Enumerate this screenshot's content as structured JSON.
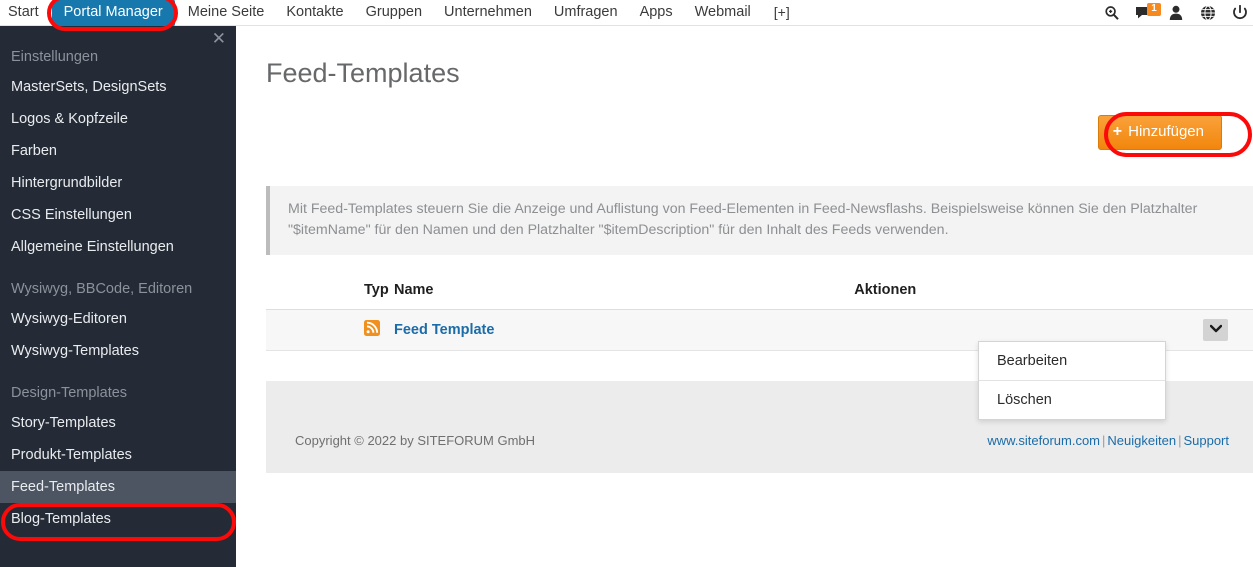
{
  "topnav": {
    "items": [
      {
        "label": "Start",
        "active": false
      },
      {
        "label": "Portal Manager",
        "active": true
      },
      {
        "label": "Meine Seite",
        "active": false
      },
      {
        "label": "Kontakte",
        "active": false
      },
      {
        "label": "Gruppen",
        "active": false
      },
      {
        "label": "Unternehmen",
        "active": false
      },
      {
        "label": "Umfragen",
        "active": false
      },
      {
        "label": "Apps",
        "active": false
      },
      {
        "label": "Webmail",
        "active": false
      },
      {
        "label": "[+]",
        "active": false
      }
    ],
    "icons": [
      {
        "name": "search-icon",
        "glyph": "⌕"
      },
      {
        "name": "messages-icon",
        "glyph": "⬛",
        "badge": "1"
      },
      {
        "name": "user-icon",
        "glyph": "♟"
      },
      {
        "name": "globe-icon",
        "glyph": "⬤"
      },
      {
        "name": "power-icon",
        "glyph": "⏻"
      }
    ],
    "active_tab_color": "#1678ad",
    "badge_color": "#f68a1e"
  },
  "sidebar": {
    "close_label": "✕",
    "groups": [
      {
        "title": "Einstellungen",
        "items": [
          {
            "label": "MasterSets, DesignSets",
            "active": false
          },
          {
            "label": "Logos & Kopfzeile",
            "active": false
          },
          {
            "label": "Farben",
            "active": false
          },
          {
            "label": "Hintergrundbilder",
            "active": false
          },
          {
            "label": "CSS Einstellungen",
            "active": false
          },
          {
            "label": "Allgemeine Einstellungen",
            "active": false
          }
        ]
      },
      {
        "title": "Wysiwyg, BBCode, Editoren",
        "items": [
          {
            "label": "Wysiwyg-Editoren",
            "active": false
          },
          {
            "label": "Wysiwyg-Templates",
            "active": false
          }
        ]
      },
      {
        "title": "Design-Templates",
        "items": [
          {
            "label": "Story-Templates",
            "active": false
          },
          {
            "label": "Produkt-Templates",
            "active": false
          },
          {
            "label": "Feed-Templates",
            "active": true
          },
          {
            "label": "Blog-Templates",
            "active": false
          }
        ]
      }
    ],
    "background_color": "#242b36",
    "active_item_color": "#4d5562"
  },
  "main": {
    "page_title": "Feed-Templates",
    "add_button": {
      "label": "Hinzufügen",
      "plus": "+",
      "color": "#f79421"
    },
    "infobox": {
      "text": "Mit Feed-Templates steuern Sie die Anzeige und Auflistung von Feed-Elementen in Feed-Newsflashs. Beispielsweise können Sie den Platzhalter \"$itemName\" für den Namen und den Platzhalter \"$itemDescription\" für den Inhalt des Feeds verwenden."
    },
    "table": {
      "headers": [
        "Typ",
        "Name",
        "Aktionen"
      ],
      "rows": [
        {
          "typ_icon": "rss-feed-icon",
          "name": "Feed Template",
          "action_caret": "∨"
        }
      ]
    },
    "dropdown": {
      "open": true,
      "items": [
        "Bearbeiten",
        "Löschen"
      ]
    },
    "footer": {
      "copyright": "Copyright © 2022 by SITEFORUM GmbH",
      "links": [
        "www.siteforum.com",
        "Neuigkeiten",
        "Support"
      ],
      "separator": "|"
    }
  },
  "annotations": {
    "color": "#fb0a0a",
    "targets": [
      "portal-manager-tab",
      "hinzufuegen-button",
      "sidebar-item-feed-templates"
    ]
  }
}
